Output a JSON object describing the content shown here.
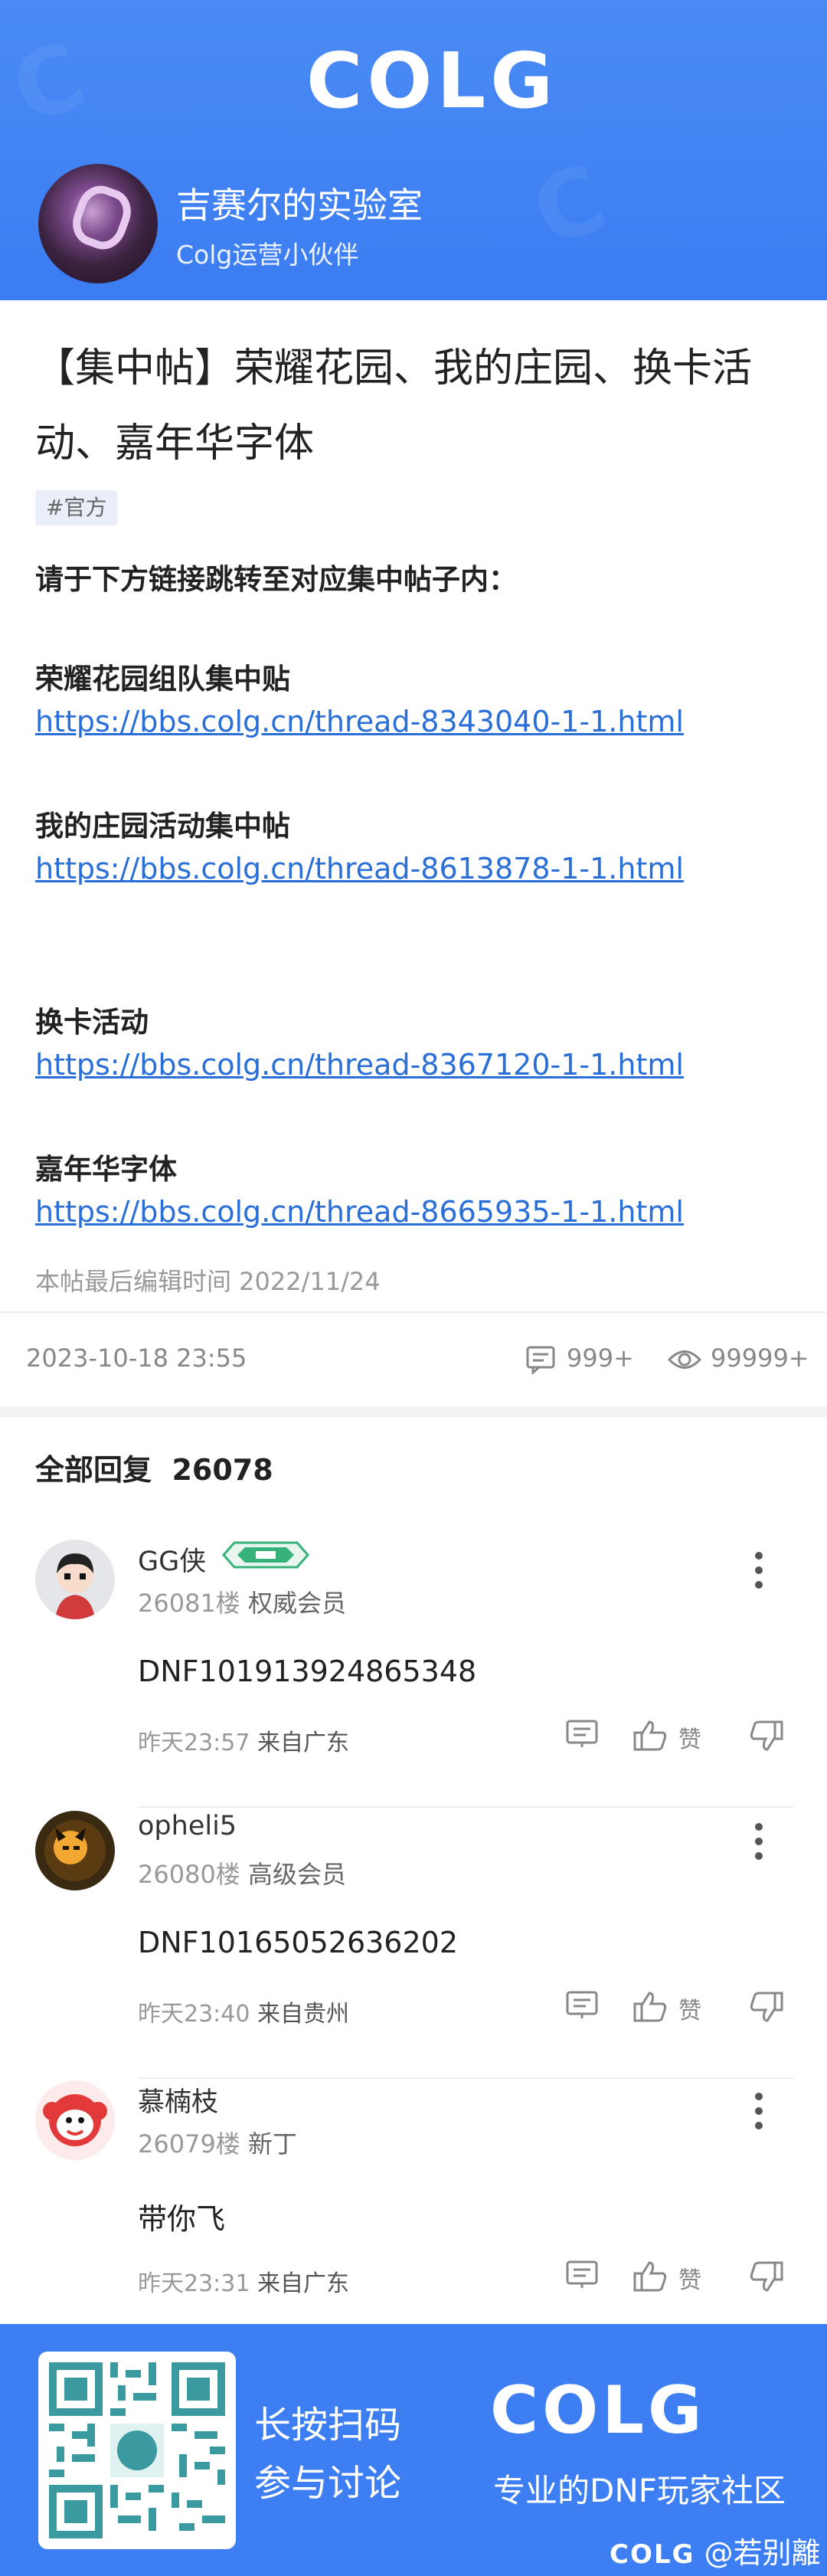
{
  "header": {
    "logo": "COLG",
    "author_name": "吉赛尔的实验室",
    "author_role": "Colg运营小伙伴"
  },
  "post": {
    "title": "【集中帖】荣耀花园、我的庄园、换卡活动、嘉年华字体",
    "tag": "#官方",
    "intro": "请于下方链接跳转至对应集中帖子内：",
    "sections": [
      {
        "title": "荣耀花园组队集中贴",
        "url": "https://bbs.colg.cn/thread-8343040-1-1.html"
      },
      {
        "title": "我的庄园活动集中帖",
        "url": "https://bbs.colg.cn/thread-8613878-1-1.html"
      },
      {
        "title": "换卡活动",
        "url": "https://bbs.colg.cn/thread-8367120-1-1.html"
      },
      {
        "title": "嘉年华字体",
        "url": "https://bbs.colg.cn/thread-8665935-1-1.html"
      }
    ],
    "edit_note": "本帖最后编辑时间 2022/11/24",
    "date": "2023-10-18 23:55",
    "comment_count": "999+",
    "view_count": "99999+"
  },
  "replies": {
    "heading": "全部回复",
    "total": "26078",
    "like_label": "赞",
    "items": [
      {
        "name": "GG侠",
        "floor": "26081楼",
        "level": "权威会员",
        "text": "DNF101913924865348",
        "time": "昨天23:57",
        "from": "来自广东"
      },
      {
        "name": "opheli5",
        "floor": "26080楼",
        "level": "高级会员",
        "text": "DNF10165052636202",
        "time": "昨天23:40",
        "from": "来自贵州"
      },
      {
        "name": "慕楠枝",
        "floor": "26079楼",
        "level": "新丁",
        "text": "带你飞",
        "time": "昨天23:31",
        "from": "来自广东"
      }
    ]
  },
  "footer": {
    "scan_line1": "长按扫码",
    "scan_line2": "参与讨论",
    "logo": "COLG",
    "slogan": "专业的DNF玩家社区",
    "credit_logo": "COLG",
    "credit_user": "@若别離"
  },
  "colors": {
    "brand_blue": "#3d7ff2",
    "link": "#2a6fd8"
  },
  "icons": [
    "comment-icon",
    "eye-icon",
    "reply-icon",
    "thumb-up-icon",
    "thumb-down-icon",
    "more-vertical-icon",
    "qr-code-icon",
    "vip-badge-icon"
  ]
}
